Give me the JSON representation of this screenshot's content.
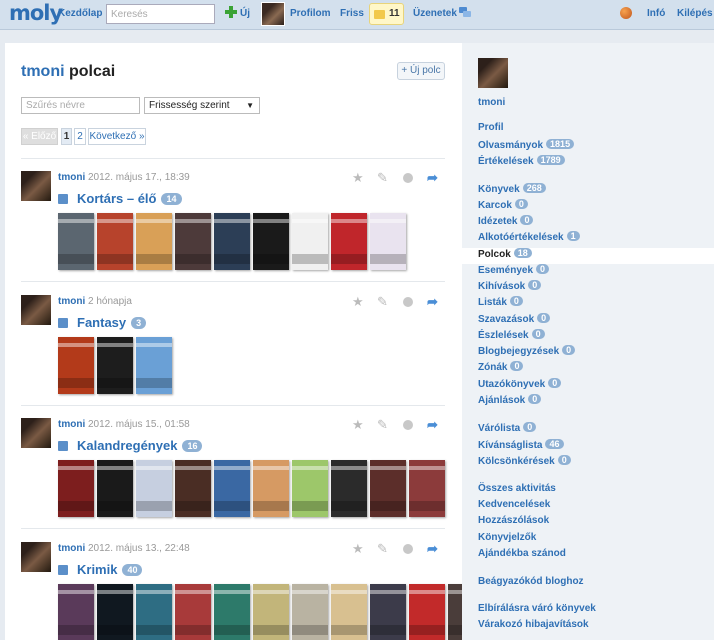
{
  "topbar": {
    "logo": "moly",
    "home": "Kezdőlap",
    "search_placeholder": "Keresés",
    "new": "Új",
    "profile": "Profilom",
    "fresh": "Friss",
    "message_count": "11",
    "messages": "Üzenetek",
    "info": "Infó",
    "logout": "Kilépés"
  },
  "page": {
    "owner": "tmoni",
    "title": "polcai",
    "new_shelf": "+ Új polc",
    "filter_placeholder": "Szűrés névre",
    "sort_value": "Frissesség szerint",
    "pager": {
      "prev": "« Előző",
      "page1": "1",
      "page2": "2",
      "next": "Következő »"
    }
  },
  "shelves": [
    {
      "user": "tmoni",
      "date": "2012. május 17., 18:39",
      "title": "Kortárs – élő",
      "count": "14"
    },
    {
      "user": "tmoni",
      "date": "2 hónapja",
      "title": "Fantasy",
      "count": "3"
    },
    {
      "user": "tmoni",
      "date": "2012. május 15., 01:58",
      "title": "Kalandregények",
      "count": "16"
    },
    {
      "user": "tmoni",
      "date": "2012. május 13., 22:48",
      "title": "Krimik",
      "count": "40"
    }
  ],
  "action_icons": {
    "star": "star-icon",
    "pencil": "pencil-icon",
    "dot": "settings-dot-icon",
    "share": "share-arrow-icon"
  },
  "cover_colors": {
    "shelf0": [
      "#5b6670",
      "#b7432c",
      "#d9a057",
      "#4d3a3a",
      "#2c3e56",
      "#1a1a1a",
      "#f0f0f0",
      "#c0262b",
      "#e9e3ef"
    ],
    "shelf1": [
      "#b33a1a",
      "#1d1d1d",
      "#6aa0d6"
    ],
    "shelf2": [
      "#7d1e1e",
      "#1a1a1a",
      "#c6cfe0",
      "#4a2d24",
      "#3a68a3",
      "#d69a63",
      "#9dc76a",
      "#2b2b2b",
      "#5c2e2a",
      "#8c3b3b"
    ],
    "shelf3": [
      "#5a3a5a",
      "#101820",
      "#2e6d83",
      "#a83a3a",
      "#2d7a6a",
      "#c2b57a",
      "#b9b3a2",
      "#d8c090",
      "#3c3b4a",
      "#c22a2a",
      "#4a3d3a"
    ]
  },
  "sidebar": {
    "user": "tmoni",
    "links": [
      {
        "label": "Profil",
        "badge": ""
      },
      {
        "label": "Olvasmányok",
        "badge": "1815"
      },
      {
        "label": "Értékelések",
        "badge": "1789"
      },
      {
        "label": "Könyvek",
        "badge": "268"
      },
      {
        "label": "Karcok",
        "badge": "0"
      },
      {
        "label": "Idézetek",
        "badge": "0"
      },
      {
        "label": "Alkotóértékelések",
        "badge": "1"
      },
      {
        "label": "Polcok",
        "badge": "18"
      },
      {
        "label": "Események",
        "badge": "0"
      },
      {
        "label": "Kihívások",
        "badge": "0"
      },
      {
        "label": "Listák",
        "badge": "0"
      },
      {
        "label": "Szavazások",
        "badge": "0"
      },
      {
        "label": "Észlelések",
        "badge": "0"
      },
      {
        "label": "Blogbejegyzések",
        "badge": "0"
      },
      {
        "label": "Zónák",
        "badge": "0"
      },
      {
        "label": "Utazókönyvek",
        "badge": "0"
      },
      {
        "label": "Ajánlások",
        "badge": "0"
      },
      {
        "label": "Várólista",
        "badge": "0"
      },
      {
        "label": "Kívánságlista",
        "badge": "46"
      },
      {
        "label": "Kölcsönkérések",
        "badge": "0"
      },
      {
        "label": "Összes aktivitás",
        "badge": ""
      },
      {
        "label": "Kedvencelések",
        "badge": ""
      },
      {
        "label": "Hozzászólások",
        "badge": ""
      },
      {
        "label": "Könyvjelzők",
        "badge": ""
      },
      {
        "label": "Ajándékba szánod",
        "badge": ""
      },
      {
        "label": "Beágyazókód bloghoz",
        "badge": ""
      },
      {
        "label": "Elbírálásra váró könyvek",
        "badge": ""
      },
      {
        "label": "Várakozó hibajavítások",
        "badge": ""
      }
    ]
  }
}
